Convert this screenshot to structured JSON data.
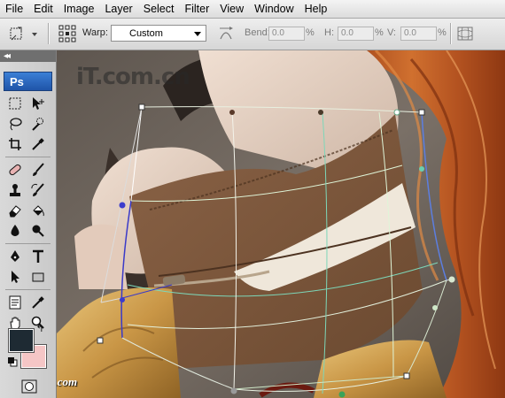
{
  "menu": [
    "File",
    "Edit",
    "Image",
    "Layer",
    "Select",
    "Filter",
    "View",
    "Window",
    "Help"
  ],
  "options": {
    "warp_label": "Warp:",
    "warp_value": "Custom",
    "bend_label": "Bend:",
    "bend_value": "0.0",
    "h_label": "H:",
    "h_value": "0.0",
    "v_label": "V:",
    "v_value": "0.0",
    "percent": "%"
  },
  "toolbox": {
    "logo": "Ps",
    "collapse": "◂◂"
  },
  "canvas": {
    "watermark_top": "iT.com.cn",
    "watermark_bottom": "www.Psjia.com"
  },
  "colors": {
    "foreground": "#1e2a33",
    "background": "#f5c6c6",
    "warp_grid": "#cfe8c8"
  }
}
